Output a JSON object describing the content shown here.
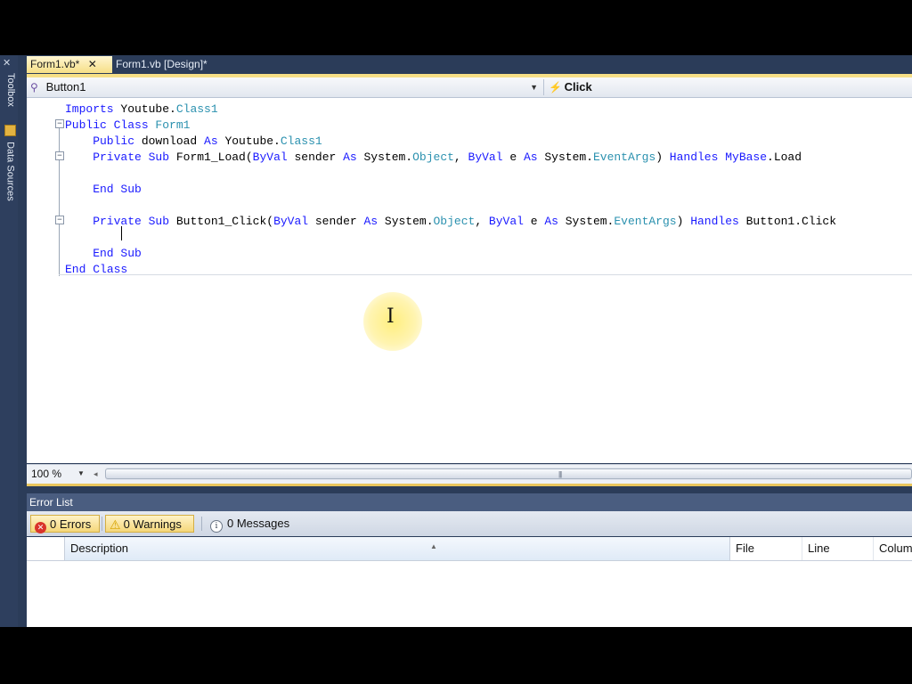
{
  "side": {
    "toolbox_label": "Toolbox",
    "data_sources_label": "Data Sources"
  },
  "tabs": [
    {
      "label": "Form1.vb*",
      "active": true
    },
    {
      "label": "Form1.vb [Design]*",
      "active": false
    }
  ],
  "nav": {
    "class_combo": "Button1",
    "method_combo": "Click"
  },
  "code_lines": [
    {
      "parts": [
        {
          "t": "Imports ",
          "c": "kw"
        },
        {
          "t": "Youtube.",
          "c": ""
        },
        {
          "t": "Class1",
          "c": "ty"
        }
      ]
    },
    {
      "parts": [
        {
          "t": "Public ",
          "c": "kw"
        },
        {
          "t": "Class ",
          "c": "kw"
        },
        {
          "t": "Form1",
          "c": "ty"
        }
      ]
    },
    {
      "parts": [
        {
          "t": "    Public ",
          "c": "kw"
        },
        {
          "t": "download ",
          "c": ""
        },
        {
          "t": "As ",
          "c": "kw"
        },
        {
          "t": "Youtube.",
          "c": ""
        },
        {
          "t": "Class1",
          "c": "ty"
        }
      ]
    },
    {
      "parts": [
        {
          "t": "    Private ",
          "c": "kw"
        },
        {
          "t": "Sub ",
          "c": "kw"
        },
        {
          "t": "Form1_Load(",
          "c": ""
        },
        {
          "t": "ByVal ",
          "c": "kw"
        },
        {
          "t": "sender ",
          "c": ""
        },
        {
          "t": "As ",
          "c": "kw"
        },
        {
          "t": "System.",
          "c": ""
        },
        {
          "t": "Object",
          "c": "ty"
        },
        {
          "t": ", ",
          "c": ""
        },
        {
          "t": "ByVal ",
          "c": "kw"
        },
        {
          "t": "e ",
          "c": ""
        },
        {
          "t": "As ",
          "c": "kw"
        },
        {
          "t": "System.",
          "c": ""
        },
        {
          "t": "EventArgs",
          "c": "ty"
        },
        {
          "t": ") ",
          "c": ""
        },
        {
          "t": "Handles ",
          "c": "kw"
        },
        {
          "t": "MyBase",
          "c": "kw"
        },
        {
          "t": ".Load",
          "c": ""
        }
      ]
    },
    {
      "parts": []
    },
    {
      "parts": [
        {
          "t": "    End ",
          "c": "kw"
        },
        {
          "t": "Sub",
          "c": "kw"
        }
      ]
    },
    {
      "parts": []
    },
    {
      "parts": [
        {
          "t": "    Private ",
          "c": "kw"
        },
        {
          "t": "Sub ",
          "c": "kw"
        },
        {
          "t": "Button1_Click(",
          "c": ""
        },
        {
          "t": "ByVal ",
          "c": "kw"
        },
        {
          "t": "sender ",
          "c": ""
        },
        {
          "t": "As ",
          "c": "kw"
        },
        {
          "t": "System.",
          "c": ""
        },
        {
          "t": "Object",
          "c": "ty"
        },
        {
          "t": ", ",
          "c": ""
        },
        {
          "t": "ByVal ",
          "c": "kw"
        },
        {
          "t": "e ",
          "c": ""
        },
        {
          "t": "As ",
          "c": "kw"
        },
        {
          "t": "System.",
          "c": ""
        },
        {
          "t": "EventArgs",
          "c": "ty"
        },
        {
          "t": ") ",
          "c": ""
        },
        {
          "t": "Handles ",
          "c": "kw"
        },
        {
          "t": "Button1.Click",
          "c": ""
        }
      ]
    },
    {
      "parts": []
    },
    {
      "parts": [
        {
          "t": "    End ",
          "c": "kw"
        },
        {
          "t": "Sub",
          "c": "kw"
        }
      ]
    },
    {
      "parts": [
        {
          "t": "End ",
          "c": "kw"
        },
        {
          "t": "Class",
          "c": "kw"
        }
      ]
    }
  ],
  "zoom": "100 %",
  "error_list": {
    "title": "Error List",
    "errors": "0 Errors",
    "warnings": "0 Warnings",
    "messages": "0 Messages",
    "columns": [
      "Description",
      "File",
      "Line",
      "Colum"
    ]
  },
  "colors": {
    "keyword": "#1a1aff",
    "type": "#2b91af",
    "active_tab": "#f6df86"
  }
}
